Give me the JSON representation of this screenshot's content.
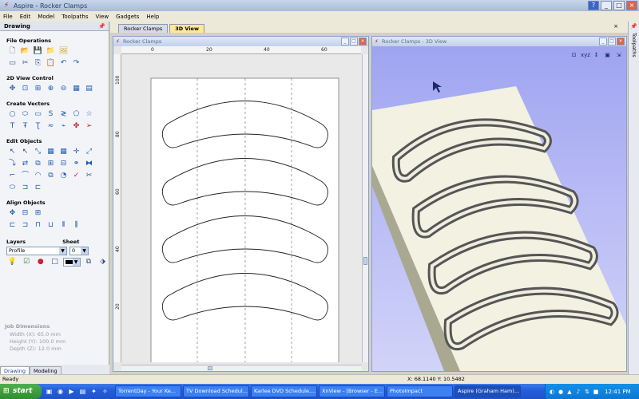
{
  "app": {
    "title": "Aspire - Rocker Clamps",
    "window_buttons": [
      "?",
      "_",
      "□",
      "×"
    ]
  },
  "menu": [
    "File",
    "Edit",
    "Model",
    "Toolpaths",
    "View",
    "Gadgets",
    "Help"
  ],
  "left_panel": {
    "header": "Drawing",
    "sections": {
      "file_operations": "File Operations",
      "view_control": "2D View Control",
      "create_vectors": "Create Vectors",
      "edit_objects": "Edit Objects",
      "align_objects": "Align Objects"
    },
    "layers_label": "Layers",
    "sheet_label": "Sheet",
    "layer_value": "Profile",
    "sheet_value": "0",
    "job_dimensions": {
      "title": "Job Dimensions",
      "width": "Width  (X): 65.0 mm",
      "height": "Height (Y): 100.0 mm",
      "depth": "Depth  (Z): 12.0 mm"
    },
    "tabs": [
      "Drawing",
      "Modeling"
    ]
  },
  "doc_tabs": [
    "Rocker Clamps",
    "3D View"
  ],
  "view2d": {
    "title": "Rocker Clamps",
    "ruler_top": [
      "0",
      "20",
      "40",
      "60"
    ],
    "ruler_left": [
      "100",
      "80",
      "60",
      "40",
      "20"
    ]
  },
  "view3d": {
    "title": "Rocker Clamps - 3D View",
    "toolbar": [
      "⊡",
      "xyz",
      "↕",
      "▣",
      "⇲"
    ]
  },
  "right_strip": "Toolpaths",
  "status": {
    "text": "Ready",
    "coords": "X: 68.1140 Y: 10.5482"
  },
  "taskbar": {
    "start": "start",
    "buttons": [
      "TorrentDay - Your Ke...",
      "TV Download Schedul...",
      "Karlee DVD Schedule....",
      "XnView - [Browser - E...",
      "PhotoImpact",
      "Aspire (Graham Ham)..."
    ],
    "clock": "12:41 PM"
  },
  "colors": {
    "view3d_bg_top": "#9fa4f0",
    "model_surface": "#f2f1e2",
    "active_tab": "#ffe79a"
  }
}
